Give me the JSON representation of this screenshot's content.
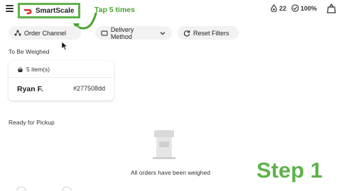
{
  "app": {
    "brand_name": "SmartScale",
    "brand_color": "#d52a1e",
    "menu_icon": "hamburger-icon"
  },
  "annotation": {
    "instruction": "Tap 5 times",
    "highlight_color": "#5fb24a",
    "step_label": "Step 1"
  },
  "status_bar": {
    "weight_count": "22",
    "battery": "100%",
    "weight_icon": "droplet-icon",
    "battery_icon": "check-circle-icon",
    "scale_icon": "scale-icon"
  },
  "filters": {
    "order_channel": "Order Channel",
    "delivery_method": "Delivery Method",
    "reset": "Reset Filters"
  },
  "to_be_weighed": {
    "title": "To Be Weighed",
    "orders": [
      {
        "item_count": "5 item(s)",
        "customer": "Ryan F.",
        "order_id": "#277508dd"
      }
    ]
  },
  "ready_for_pickup": {
    "title": "Ready for Pickup",
    "empty_message": "All orders have been weighed"
  }
}
